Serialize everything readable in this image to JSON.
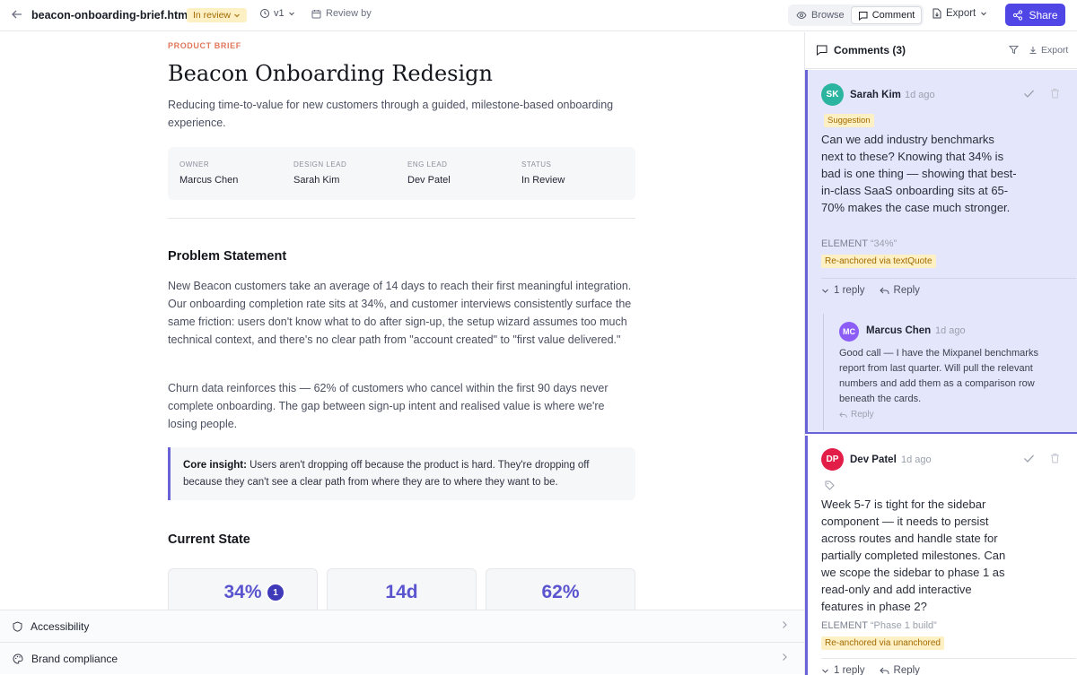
{
  "topbar": {
    "file_name": "beacon-onboarding-brief.html",
    "status": "In review",
    "version": "v1",
    "review_by": "Review by",
    "modes": [
      "Browse",
      "Comment"
    ],
    "active_mode": "Comment",
    "export_label": "Export",
    "share_label": "Share"
  },
  "doc": {
    "eyebrow": "PRODUCT BRIEF",
    "title": "Beacon Onboarding Redesign",
    "subtitle": "Reducing time-to-value for new customers through a guided, milestone-based onboarding experience.",
    "meta": [
      {
        "label": "OWNER",
        "value": "Marcus Chen"
      },
      {
        "label": "DESIGN LEAD",
        "value": "Sarah Kim"
      },
      {
        "label": "ENG LEAD",
        "value": "Dev Patel"
      },
      {
        "label": "STATUS",
        "value": "In Review"
      }
    ],
    "problem_heading": "Problem Statement",
    "problem_p1": "New Beacon customers take an average of 14 days to reach their first meaningful integration. Our onboarding completion rate sits at 34%, and customer interviews consistently surface the same friction: users don't know what to do after sign-up, the setup wizard assumes too much technical context, and there's no clear path from \"account created\" to \"first value delivered.\"",
    "problem_p2": "Churn data reinforces this — 62% of customers who cancel within the first 90 days never complete onboarding. The gap between sign-up intent and realised value is where we're losing people.",
    "insight_label": "Core insight:",
    "insight_text": " Users aren't dropping off because the product is hard. They're dropping off because they can't see a clear path from where they are to where they want to be.",
    "current_heading": "Current State",
    "stats": [
      "34%",
      "14d",
      "62%"
    ],
    "stat_badge": "1"
  },
  "bottom_panels": [
    "Accessibility",
    "Brand compliance"
  ],
  "comments": {
    "title": "Comments (3)",
    "export_label": "Export",
    "threads": [
      {
        "initials": "SK",
        "author": "Sarah Kim",
        "time": "1d ago",
        "tag": "Suggestion",
        "text": "Can we add industry benchmarks next to these? Knowing that 34% is bad is one thing — showing that best-in-class SaaS onboarding sits at 65-70% makes the case much stronger.",
        "element_label": "ELEMENT",
        "element_quote": "“34%”",
        "anchor": "Re-anchored via textQuote",
        "replies_count": "1 reply",
        "reply_label": "Reply",
        "reply": {
          "initials": "MC",
          "author": "Marcus Chen",
          "time": "1d ago",
          "text": "Good call — I have the Mixpanel benchmarks report from last quarter. Will pull the relevant numbers and add them as a comparison row beneath the cards.",
          "reply_label": "Reply"
        }
      },
      {
        "initials": "DP",
        "author": "Dev Patel",
        "time": "1d ago",
        "text": "Week 5-7 is tight for the sidebar component — it needs to persist across routes and handle state for partially completed milestones. Can we scope the sidebar to phase 1 as read-only and add interactive features in phase 2?",
        "element_label": "ELEMENT",
        "element_quote": "“Phase 1 build”",
        "anchor": "Re-anchored via unanchored",
        "replies_count": "1 reply",
        "reply_label": "Reply"
      }
    ]
  },
  "colors": {
    "accent": "#4f46e5",
    "sk_avatar": "#2bb5a0",
    "mc_avatar": "#8b5cf6",
    "dp_avatar": "#e11d48",
    "highlight": "#fdf0c4"
  }
}
